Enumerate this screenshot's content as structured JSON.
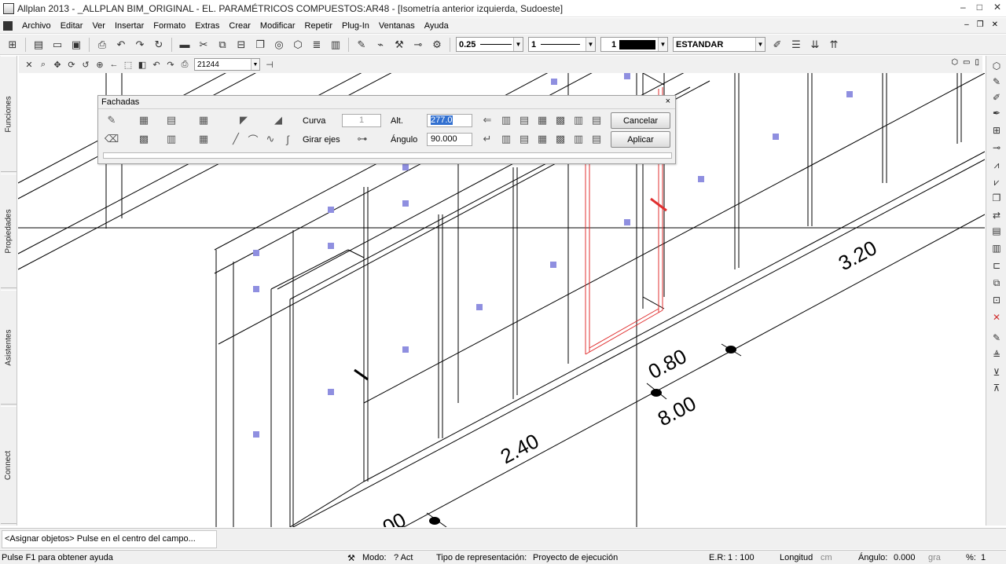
{
  "window": {
    "title": "Allplan 2013 - _ALLPLAN BIM_ORIGINAL - EL. PARAMÉTRICOS COMPUESTOS:AR48 - [Isometría anterior izquierda, Sudoeste]",
    "minimize": "–",
    "maximize": "□",
    "close": "✕"
  },
  "menu": {
    "items": [
      "Archivo",
      "Editar",
      "Ver",
      "Insertar",
      "Formato",
      "Extras",
      "Crear",
      "Modificar",
      "Repetir",
      "Plug-In",
      "Ventanas",
      "Ayuda"
    ],
    "mdi_minimize": "–",
    "mdi_restore": "❐",
    "mdi_close": "✕"
  },
  "toolbar": {
    "pen_value": "0.25",
    "line_value": "1",
    "color_value": "1",
    "layer_value": "ESTANDAR",
    "icons": [
      "grid-icon",
      "layout-icon",
      "sheet-icon",
      "image-icon",
      "print-icon",
      "undo-icon",
      "redo-icon",
      "refresh-icon",
      "ruler-icon",
      "scissors-icon",
      "copy-icon",
      "paste-icon",
      "window-icon",
      "view-icon",
      "cube-icon",
      "layers-icon",
      "save-icon",
      "pipette-icon",
      "brush-icon",
      "format-painter-icon",
      "pin-icon",
      "settings-icon"
    ],
    "trailing_icons": [
      "pencil-icon",
      "stack-icon",
      "stack-down-icon",
      "stack-up-icon"
    ]
  },
  "toolbar2": {
    "layer_field": "21244",
    "icons": [
      "close-view-icon",
      "zoom-icon",
      "pan-icon",
      "rotate-icon",
      "redraw-icon",
      "zoom-window-icon",
      "arrow-left-icon",
      "select-icon",
      "split-icon",
      "undo-view-icon",
      "redo-view-icon",
      "print-view-icon"
    ],
    "right_icons": [
      "cube-view-icon",
      "sheet-view-icon",
      "page-view-icon"
    ]
  },
  "left_tabs": [
    "Funciones",
    "Propiedades",
    "Asistentes",
    "Connect"
  ],
  "dialog": {
    "title": "Fachadas",
    "curve_label": "Curva",
    "curve_value": "1",
    "rotate_axes_label": "Girar ejes",
    "height_label": "Alt.",
    "height_value": "277.0",
    "angle_label": "Ángulo",
    "angle_value": "90.000",
    "cancel_label": "Cancelar",
    "apply_label": "Aplicar",
    "close_label": "×"
  },
  "drawing": {
    "dimensions": [
      "3.20",
      "0.80",
      "8.00",
      "2.40",
      "00"
    ]
  },
  "command_line": {
    "prompt": "<Asignar objetos> Pulse en el centro del campo..."
  },
  "status": {
    "help": "Pulse F1 para obtener ayuda",
    "mode_label": "Modo:",
    "mode_value": "? Act",
    "repr_label": "Tipo de representación:",
    "repr_value": "Proyecto de ejecución",
    "scale_label": "E.R:",
    "scale_value": "1 : 100",
    "length_label": "Longitud",
    "length_unit": "cm",
    "angle_label": "Ángulo:",
    "angle_value": "0.000",
    "angle_unit": "gra",
    "percent_label": "%:",
    "percent_value": "1"
  },
  "colors": {
    "background": "#ffffff",
    "chrome": "#f0f0f0",
    "marker": "#8f8fe0",
    "selected_element": "#e03030"
  }
}
